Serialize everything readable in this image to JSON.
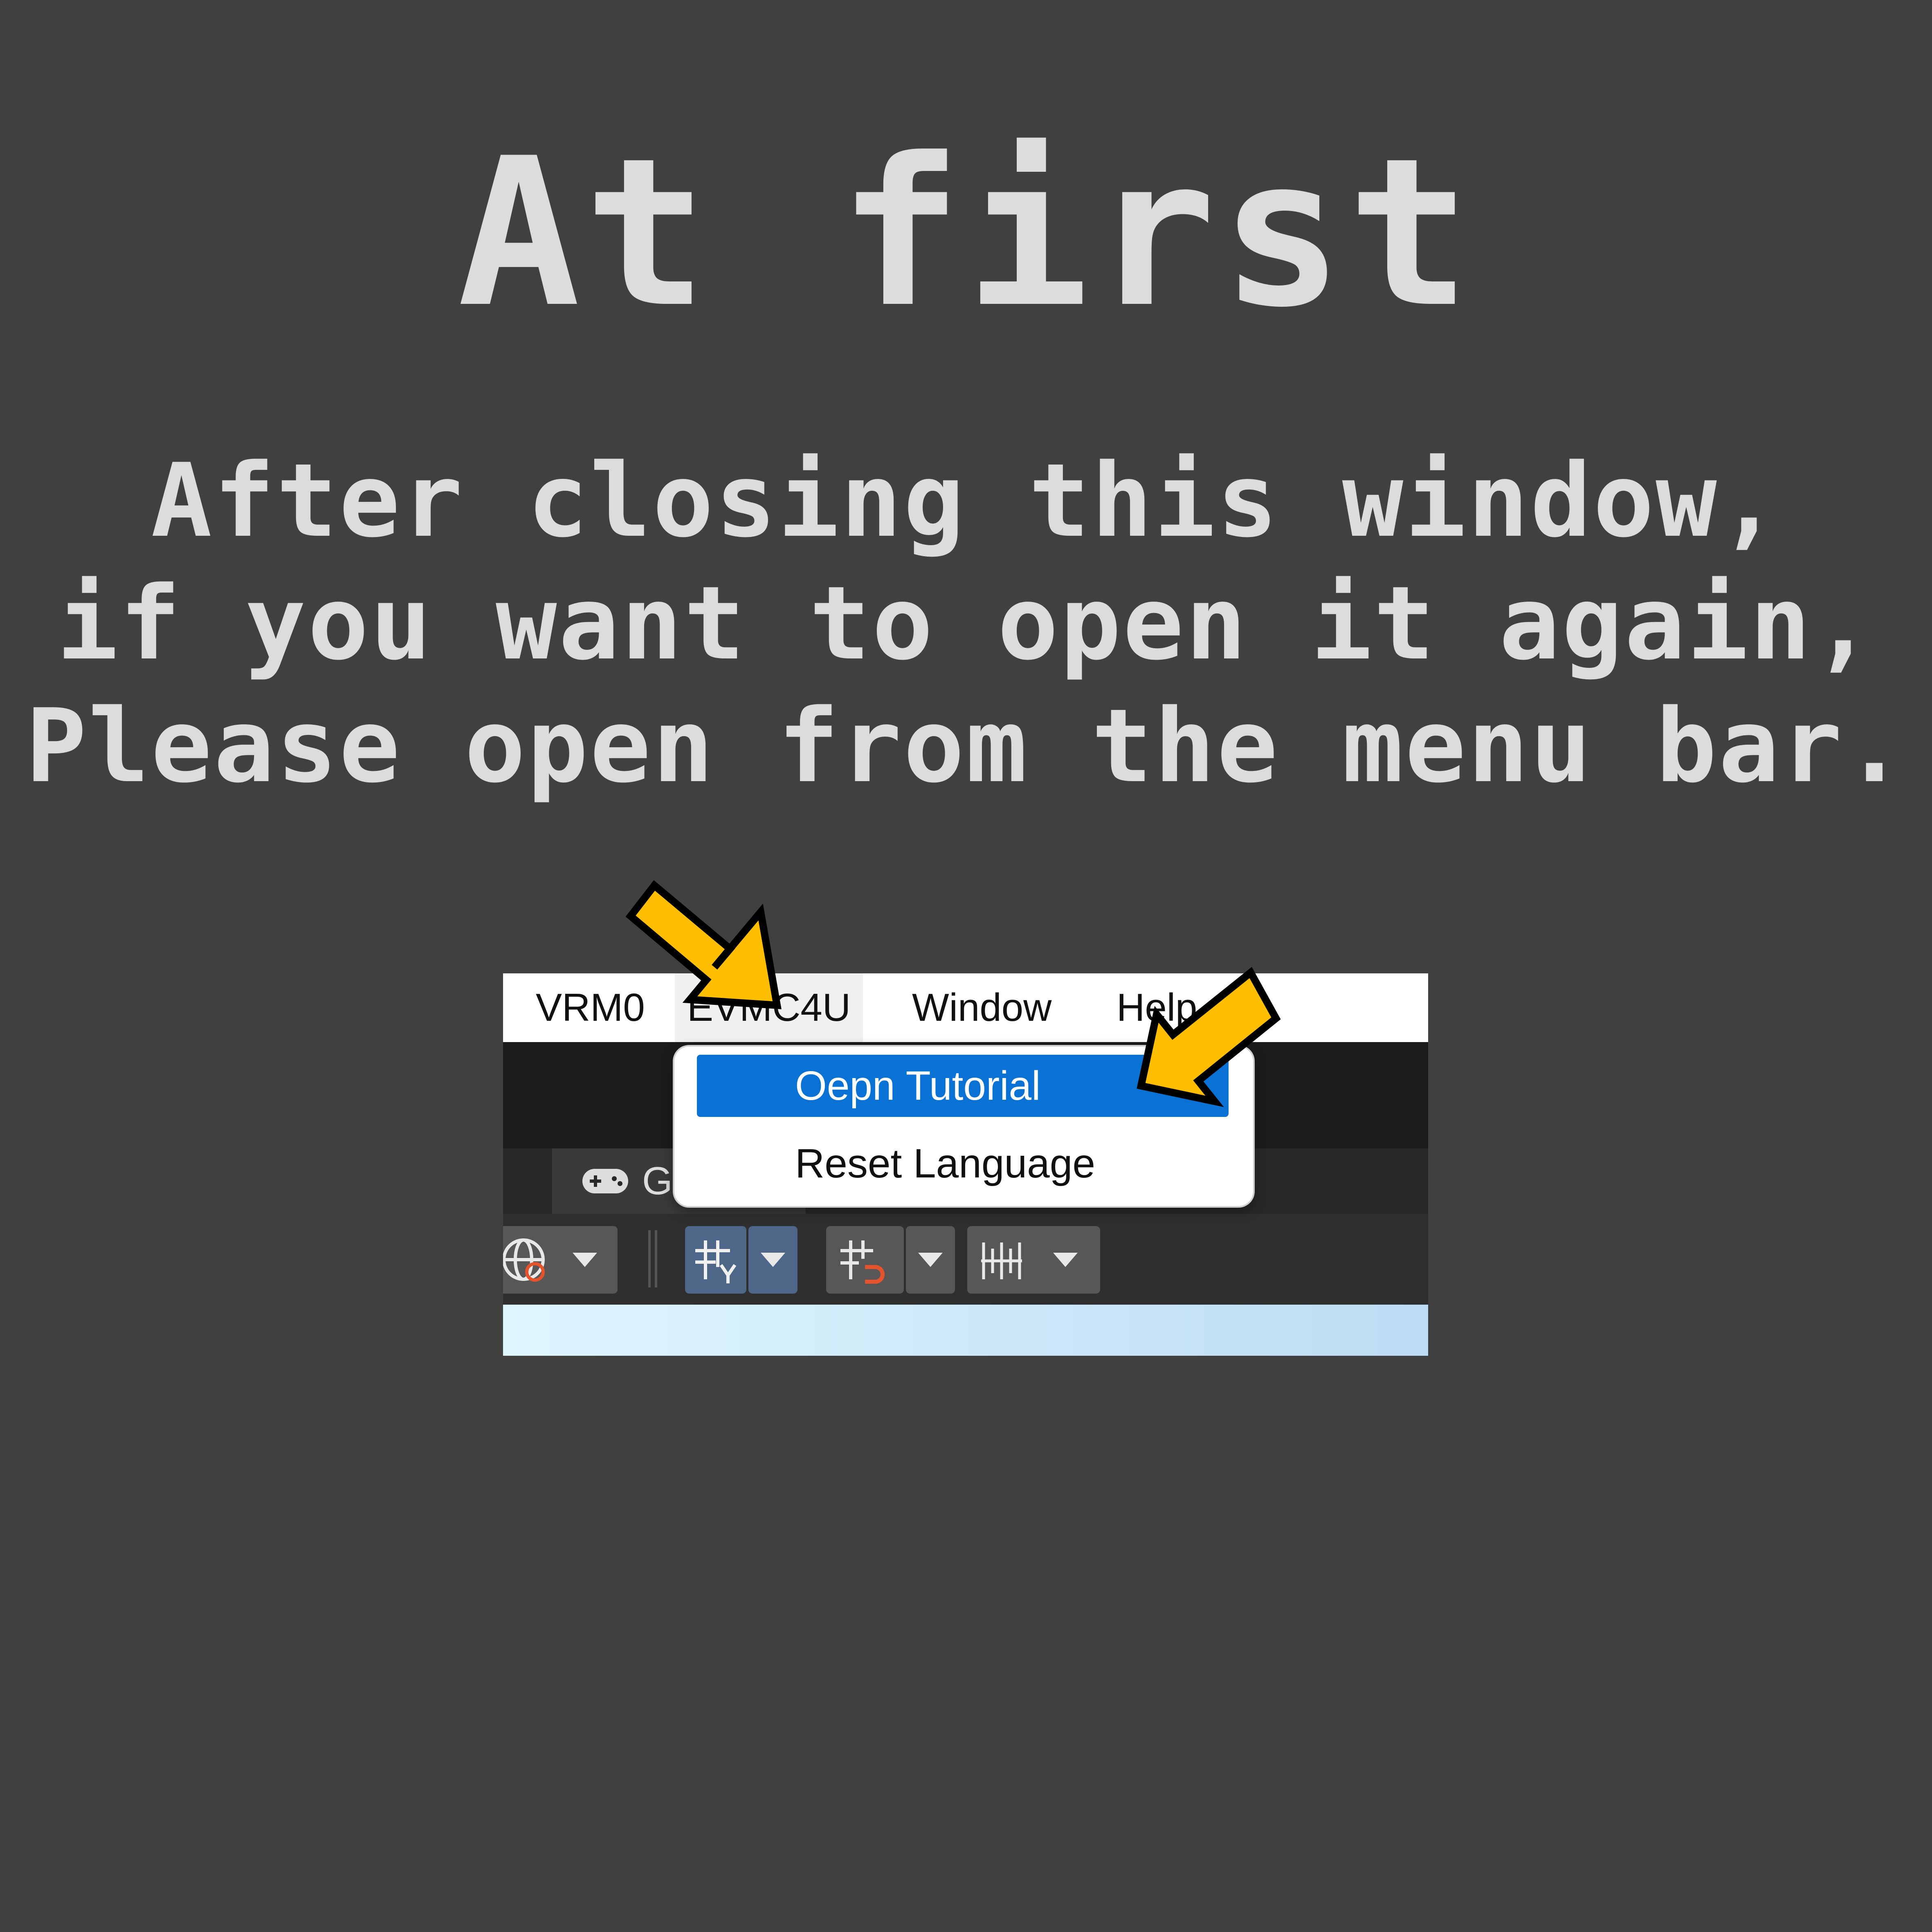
{
  "heading": "At first",
  "instructions": [
    "After closing this window,",
    "if you want to open it again,",
    "Please open from the menu bar."
  ],
  "screenshot": {
    "menubar": {
      "items": [
        "VRM0",
        "EVMC4U",
        "Window",
        "Help"
      ],
      "active_item": "EVMC4U"
    },
    "tab": {
      "label": "G",
      "icon": "gamepad-icon"
    },
    "toolbar": {
      "buttons": [
        {
          "icon": "globe-icon",
          "active": false
        },
        {
          "icon": "grid-y-icon",
          "active": true
        },
        {
          "icon": "grid-magnet-icon",
          "active": false
        },
        {
          "icon": "ruler-icon",
          "active": false
        }
      ]
    },
    "dropdown": {
      "items": [
        "Oepn Tutorial",
        "Reset Language"
      ],
      "selected_index": 0
    }
  },
  "colors": {
    "background": "#404040",
    "text": "#dcdcdc",
    "arrow": "#ffbe00",
    "selection": "#0a72d5"
  }
}
